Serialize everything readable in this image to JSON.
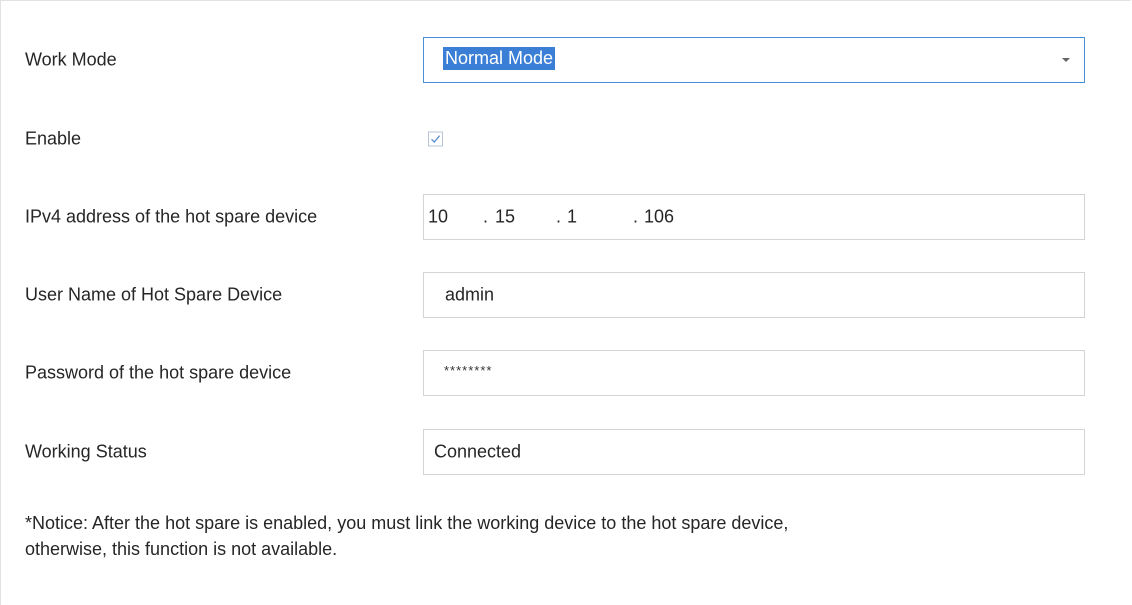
{
  "form": {
    "work_mode": {
      "label": "Work Mode",
      "value": "Normal Mode"
    },
    "enable": {
      "label": "Enable",
      "checked": true
    },
    "ipv4": {
      "label": "IPv4 address of the hot spare device",
      "octets": [
        "10",
        "15",
        "1",
        "106"
      ],
      "separator": "."
    },
    "username": {
      "label": "User Name of Hot Spare Device",
      "value": "admin"
    },
    "password": {
      "label": "Password of the hot spare device",
      "value": "********"
    },
    "working_status": {
      "label": "Working Status",
      "value": "Connected"
    }
  },
  "notice": {
    "line1": "*Notice: After the hot spare is enabled, you must link the working device to the hot spare device,",
    "line2": "otherwise, this function is not available."
  },
  "colors": {
    "select_border": "#4a90d9",
    "selection_highlight": "#3a7fd5",
    "field_border": "#d4d4d4",
    "text": "#262626"
  },
  "icons": {
    "dropdown": "chevron-down-icon",
    "checkbox": "check-icon"
  }
}
